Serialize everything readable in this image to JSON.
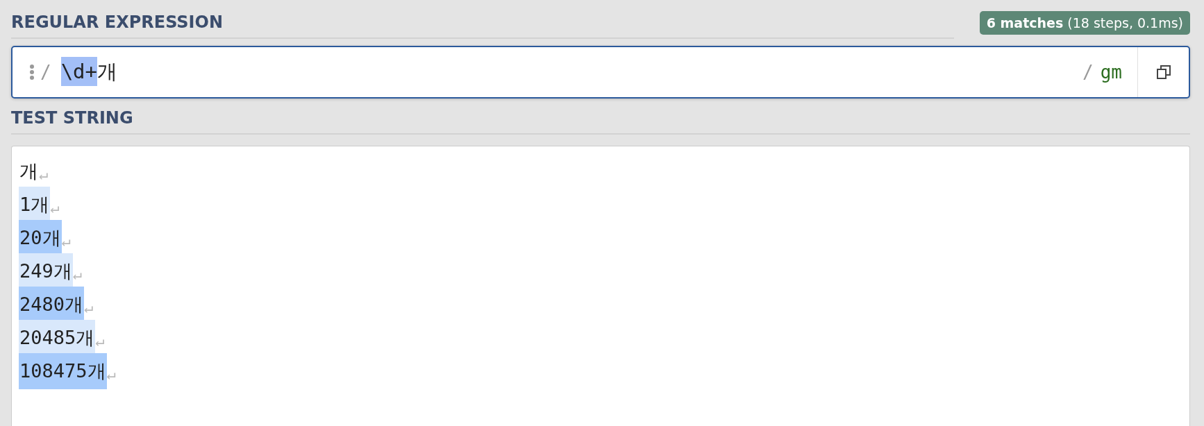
{
  "regex_section": {
    "heading": "REGULAR EXPRESSION",
    "match_info": "**6 matches** (18 steps, 0.1ms)",
    "open_delimiter": "/",
    "parts": [
      {
        "text": "\\d+",
        "selected": true
      },
      {
        "text": "개",
        "selected": false
      }
    ],
    "close_delimiter": "/",
    "flags": "gm"
  },
  "test_section": {
    "heading": "TEST STRING",
    "lines": [
      {
        "text": "개",
        "matched": false,
        "eol": "↵"
      },
      {
        "text": "1개",
        "matched": true,
        "alternate": false,
        "eol": "↵"
      },
      {
        "text": "20개",
        "matched": true,
        "alternate": true,
        "eol": "↵"
      },
      {
        "text": "249개",
        "matched": true,
        "alternate": false,
        "eol": "↵"
      },
      {
        "text": "2480개",
        "matched": true,
        "alternate": true,
        "eol": "↵"
      },
      {
        "text": "20485개",
        "matched": true,
        "alternate": false,
        "eol": "↵"
      },
      {
        "text": "108475개",
        "matched": true,
        "alternate": true,
        "eol": "↵"
      }
    ]
  }
}
